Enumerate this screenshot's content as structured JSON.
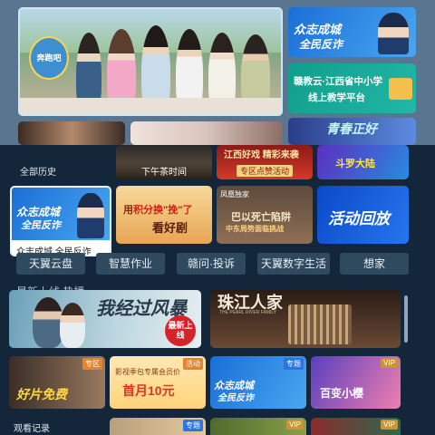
{
  "top": {
    "hero": {
      "show_logo": "奔跑吧"
    },
    "ads": [
      {
        "line1": "众志成城",
        "line2": "全民反诈"
      },
      {
        "line1": "赣教云·江西省中小学",
        "line2": "线上教学平台"
      },
      {
        "text": "青春正好"
      }
    ]
  },
  "rows": {
    "history_label": "全部历史",
    "row1": [
      {
        "title": "下午茶时间"
      },
      {
        "title": "专区点赞活动",
        "subtitle": "江西好戏 精彩来袭"
      },
      {
        "title": "斗罗大陆"
      }
    ],
    "featured": {
      "line1": "众志成城",
      "line2": "全民反诈",
      "label": "众志成城 全民反诈"
    },
    "row2": [
      {
        "text1": "用",
        "highlight": "积分换",
        "text2": "\"挽\"了",
        "text3": "看好剧"
      },
      {
        "tag": "凤凰独家",
        "title": "巴以死亡陷阱",
        "subtitle": "中东局势面临挑战"
      },
      {
        "title": "活动回放"
      }
    ],
    "buttons": [
      {
        "label": "天翼云盘"
      },
      {
        "label": "智慧作业"
      },
      {
        "label": "赣问·投诉"
      },
      {
        "label": "天翼数字生活"
      },
      {
        "label": "想家"
      }
    ],
    "section_title": "最新上线 热播",
    "row3": [
      {
        "title": "我经过风暴",
        "badge": "最新上线"
      },
      {
        "title": "珠江人家",
        "subtitle": "THE PEARL RIVER FAMILY"
      }
    ],
    "row4": [
      {
        "tag": "专区",
        "title": "好片免费"
      },
      {
        "tag": "活动",
        "title": "影视季包专属会员价",
        "price": "首月10元"
      },
      {
        "tag": "专题",
        "line1": "众志成城",
        "line2": "全民反诈"
      },
      {
        "tag": "VIP",
        "title": "百变小樱"
      }
    ],
    "watch_record": "观看记录",
    "row5_tags": [
      "专题",
      "VIP",
      "VIP"
    ]
  }
}
